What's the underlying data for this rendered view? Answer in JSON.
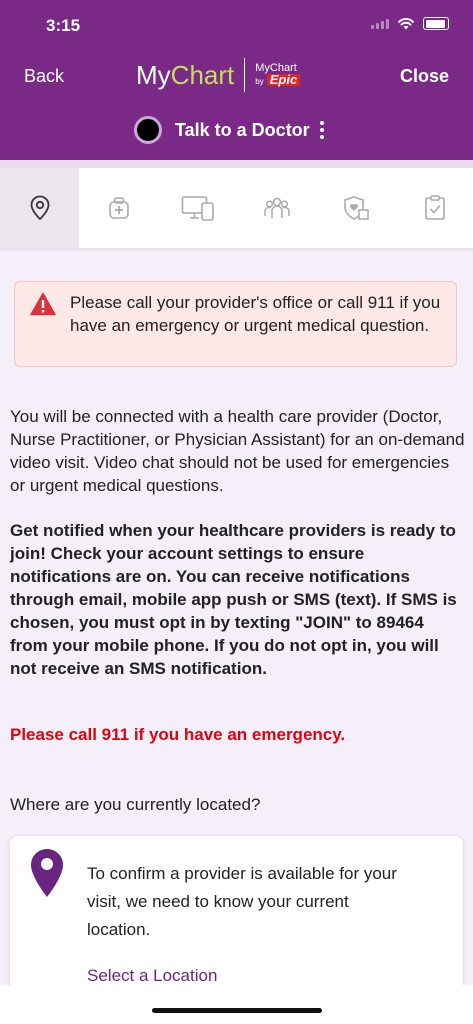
{
  "status_bar": {
    "time": "3:15"
  },
  "header": {
    "back_label": "Back",
    "close_label": "Close",
    "logo_my": "My",
    "logo_chart": "Chart",
    "logo_sub_top": "MyChart",
    "logo_sub_by": "by",
    "logo_sub_epic": "Epic",
    "visit_title": "Talk to a Doctor"
  },
  "tabs": [
    {
      "icon": "location-pin-icon",
      "active": true
    },
    {
      "icon": "medical-bag-icon",
      "active": false
    },
    {
      "icon": "devices-icon",
      "active": false
    },
    {
      "icon": "people-icon",
      "active": false
    },
    {
      "icon": "shield-heart-icon",
      "active": false
    },
    {
      "icon": "clipboard-check-icon",
      "active": false
    }
  ],
  "alert": {
    "text": "Please call your provider's office or call 911 if you have an emergency or urgent medical question."
  },
  "content": {
    "intro": "You will be connected with a health care provider (Doctor, Nurse Practitioner, or Physician Assistant) for an on-demand video visit. Video chat should not be used for emergencies or urgent medical questions.",
    "notify": "Get notified when your healthcare providers is ready to join! Check your account settings to ensure notifications are on. You can receive notifications through email, mobile app push or SMS (text). If SMS is chosen, you must opt in by texting \"JOIN\" to 89464 from your mobile phone. If you do not opt in, you will not receive an SMS notification.",
    "emergency": "Please call 911 if you have an emergency.",
    "location_question": "Where are you currently located?"
  },
  "location_card": {
    "text": "To confirm a provider is available for your visit, we need to know your current location.",
    "link": "Select a Location"
  },
  "colors": {
    "brand_purple": "#7a2a86",
    "logo_green": "#c6dd5e",
    "emergency_red": "#e3000f",
    "link_purple": "#6b2580"
  }
}
